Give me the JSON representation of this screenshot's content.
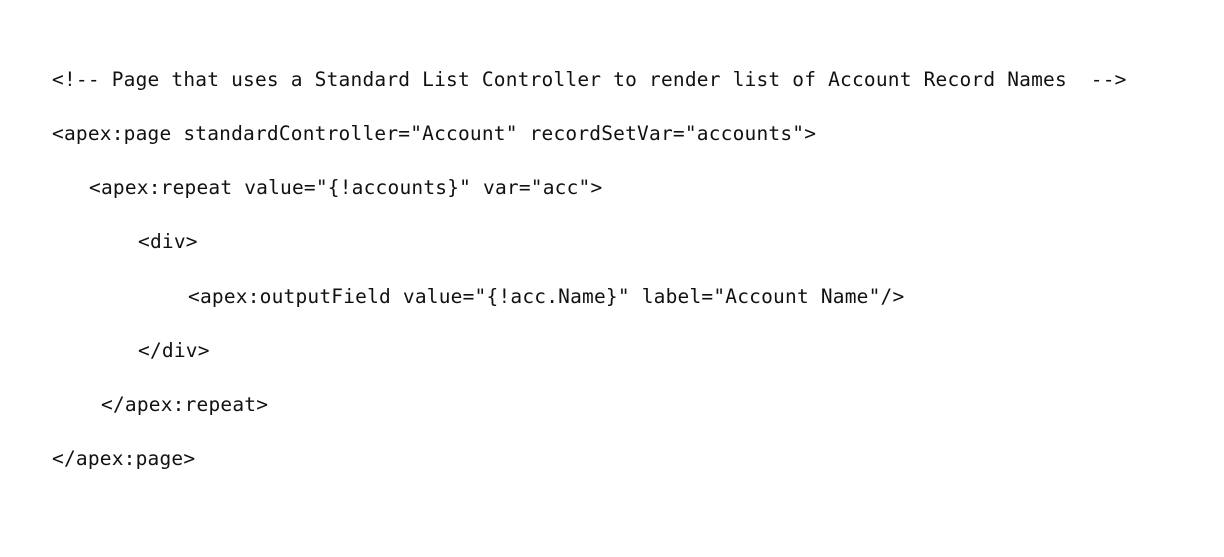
{
  "code": {
    "lines": [
      "<!-- Page that uses a Standard List Controller to render list of Account Record Names  -->",
      "<apex:page standardController=\"Account\" recordSetVar=\"accounts\">",
      "<apex:repeat value=\"{!accounts}\" var=\"acc\">",
      "<div>",
      "<apex:outputField value=\"{!acc.Name}\" label=\"Account Name\"/>",
      "</div>",
      "</apex:repeat>",
      "</apex:page>"
    ]
  }
}
